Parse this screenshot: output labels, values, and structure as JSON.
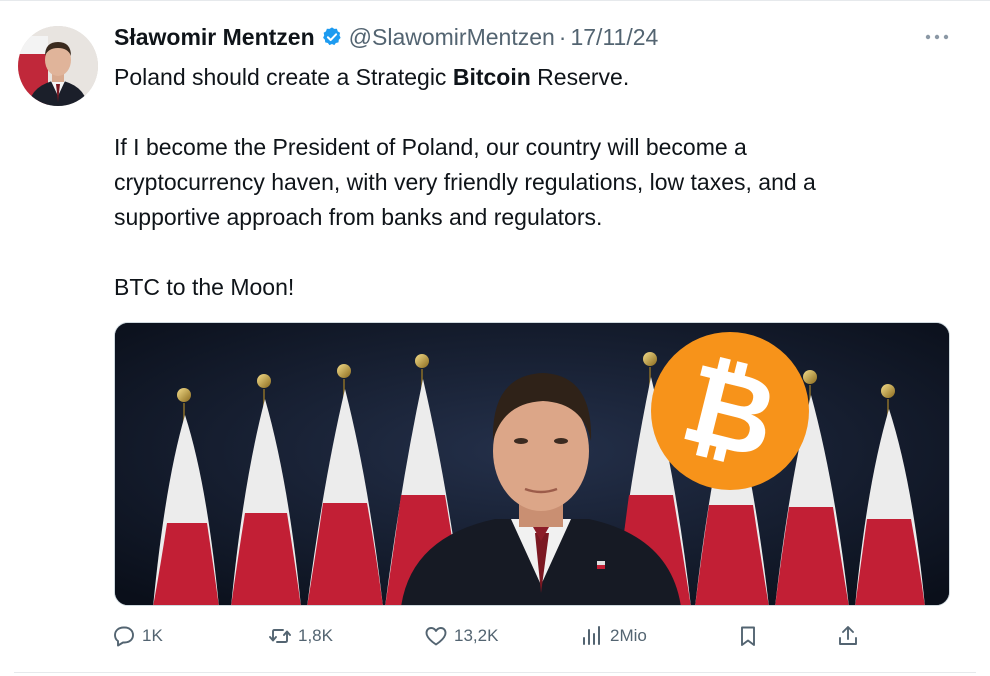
{
  "tweet": {
    "author_name": "Sławomir Mentzen",
    "handle": "@SlawomirMentzen",
    "separator": "·",
    "date": "17/11/24",
    "line1_pre": "Poland should create a Strategic ",
    "line1_bold": "Bitcoin",
    "line1_post": " Reserve.",
    "para2_l1": "If I become the President of Poland, our country will become a",
    "para2_l2": "cryptocurrency haven, with very friendly regulations, low taxes, and a",
    "para2_l3": "supportive approach from banks and regulators.",
    "para3": "BTC to the Moon!",
    "bitcoin_glyph": "₿"
  },
  "actions": {
    "replies": "1K",
    "reposts": "1,8K",
    "likes": "13,2K",
    "views": "2Mio"
  },
  "icons": [
    "verified-icon",
    "more-icon",
    "reply-icon",
    "repost-icon",
    "like-icon",
    "views-icon",
    "bookmark-icon",
    "share-icon",
    "bitcoin-icon"
  ],
  "colors": {
    "verified": "#1d9bf0",
    "text": "#0f1419",
    "muted": "#536471",
    "bitcoin": "#f7931a",
    "flag_red": "#d4213d"
  }
}
